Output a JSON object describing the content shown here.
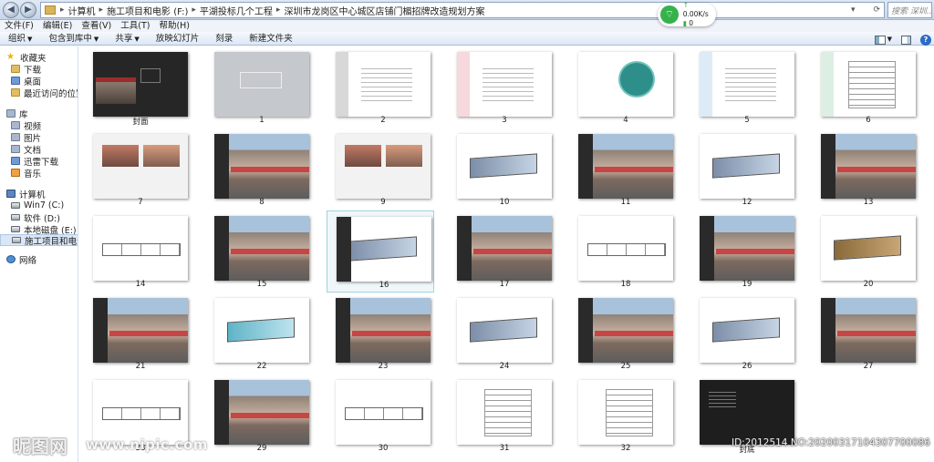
{
  "address_bar": {
    "crumbs": [
      "计算机",
      "施工项目和电影 (F:)",
      "平湖投标几个工程",
      "深圳市龙岗区中心城区店铺门楣招牌改造规划方案"
    ],
    "search_placeholder": "搜索 深圳..."
  },
  "network": {
    "upload": "0.00K/s",
    "download": "0"
  },
  "menu": [
    "文件(F)",
    "编辑(E)",
    "查看(V)",
    "工具(T)",
    "帮助(H)"
  ],
  "toolbar": {
    "organize": "组织",
    "include_in_library": "包含到库中",
    "share": "共享",
    "slideshow": "放映幻灯片",
    "burn": "刻录",
    "new_folder": "新建文件夹"
  },
  "sidebar": {
    "favorites": "收藏夹",
    "downloads": "下载",
    "desktop": "桌面",
    "recent": "最近访问的位置",
    "libraries": "库",
    "videos": "视频",
    "pictures": "图片",
    "documents": "文档",
    "thunder": "迅雷下载",
    "music": "音乐",
    "computer": "计算机",
    "drive_c": "Win7 (C:)",
    "drive_d": "软件 (D:)",
    "drive_e": "本地磁盘 (E:)",
    "drive_f": "施工项目和电影 (F:)",
    "network": "网络"
  },
  "files": [
    {
      "label": "封面",
      "style": "cover"
    },
    {
      "label": "1",
      "style": "gray"
    },
    {
      "label": "2",
      "style": "doc"
    },
    {
      "label": "3",
      "style": "pink"
    },
    {
      "label": "4",
      "style": "map"
    },
    {
      "label": "5",
      "style": "blue"
    },
    {
      "label": "6",
      "style": "green"
    },
    {
      "label": "7",
      "style": "photo"
    },
    {
      "label": "8",
      "style": "street"
    },
    {
      "label": "9",
      "style": "photo"
    },
    {
      "label": "10",
      "style": "rend"
    },
    {
      "label": "11",
      "style": "street"
    },
    {
      "label": "12",
      "style": "rend"
    },
    {
      "label": "13",
      "style": "street"
    },
    {
      "label": "14",
      "style": "elev"
    },
    {
      "label": "15",
      "style": "street"
    },
    {
      "label": "16",
      "style": "rend-side",
      "selected": true
    },
    {
      "label": "17",
      "style": "street"
    },
    {
      "label": "18",
      "style": "elev"
    },
    {
      "label": "19",
      "style": "street"
    },
    {
      "label": "20",
      "style": "rend-gold"
    },
    {
      "label": "21",
      "style": "street"
    },
    {
      "label": "22",
      "style": "rend-cyan"
    },
    {
      "label": "23",
      "style": "street"
    },
    {
      "label": "24",
      "style": "rend"
    },
    {
      "label": "25",
      "style": "street"
    },
    {
      "label": "26",
      "style": "rend"
    },
    {
      "label": "27",
      "style": "street"
    },
    {
      "label": "28",
      "style": "elev"
    },
    {
      "label": "29",
      "style": "street"
    },
    {
      "label": "30",
      "style": "elev"
    },
    {
      "label": "31",
      "style": "table"
    },
    {
      "label": "32",
      "style": "table"
    },
    {
      "label": "封底",
      "style": "dark"
    }
  ],
  "watermark": {
    "logo": "昵图网",
    "url": "www.nipic.com",
    "id": "ID:2012514 NO:20200317104307700086"
  }
}
